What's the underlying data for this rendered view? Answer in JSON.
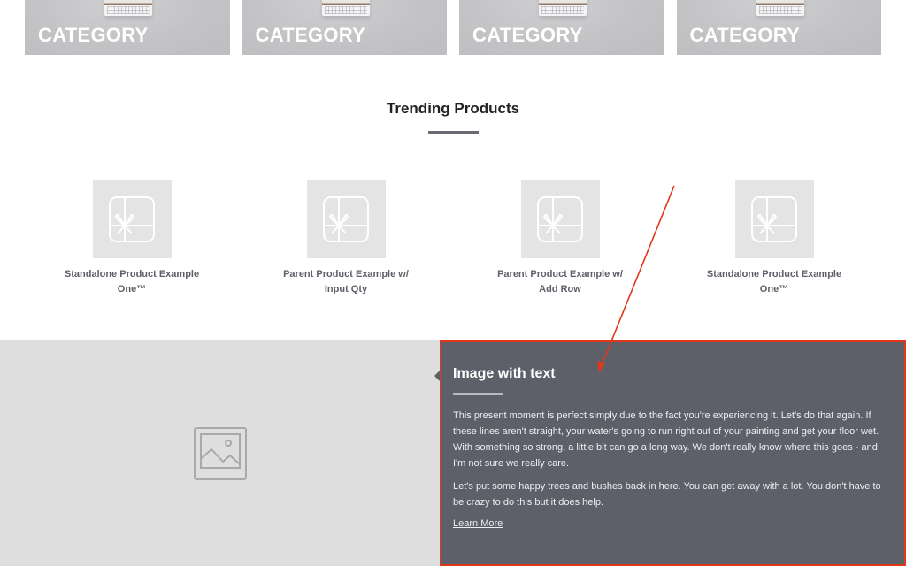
{
  "categories": [
    {
      "label": "CATEGORY"
    },
    {
      "label": "CATEGORY"
    },
    {
      "label": "CATEGORY"
    },
    {
      "label": "CATEGORY"
    }
  ],
  "trending": {
    "title": "Trending Products",
    "products": [
      {
        "name": "Standalone Product Example One™",
        "icon": "gift-card-icon"
      },
      {
        "name": "Parent Product Example w/ Input Qty",
        "icon": "gift-card-icon"
      },
      {
        "name": "Parent Product Example w/ Add Row",
        "icon": "gift-card-icon"
      },
      {
        "name": "Standalone Product Example One™",
        "icon": "gift-card-icon"
      }
    ]
  },
  "image_with_text": {
    "image_icon": "image-placeholder-icon",
    "title": "Image with text",
    "paragraphs": [
      "This present moment is perfect simply due to the fact you're experiencing it. Let's do that again. If these lines aren't straight, your water's going to run right out of your painting and get your floor wet. With something so strong, a little bit can go a long way. We don't really know where this goes - and I'm not sure we really care.",
      "Let's put some happy trees and bushes back in here. You can get away with a lot. You don't have to be crazy to do this but it does help."
    ],
    "link_label": "Learn More"
  },
  "colors": {
    "panel_bg": "#5d6068",
    "highlight": "#e0381a",
    "image_placeholder_bg": "#dedede",
    "product_thumb_bg": "#e4e4e4"
  }
}
